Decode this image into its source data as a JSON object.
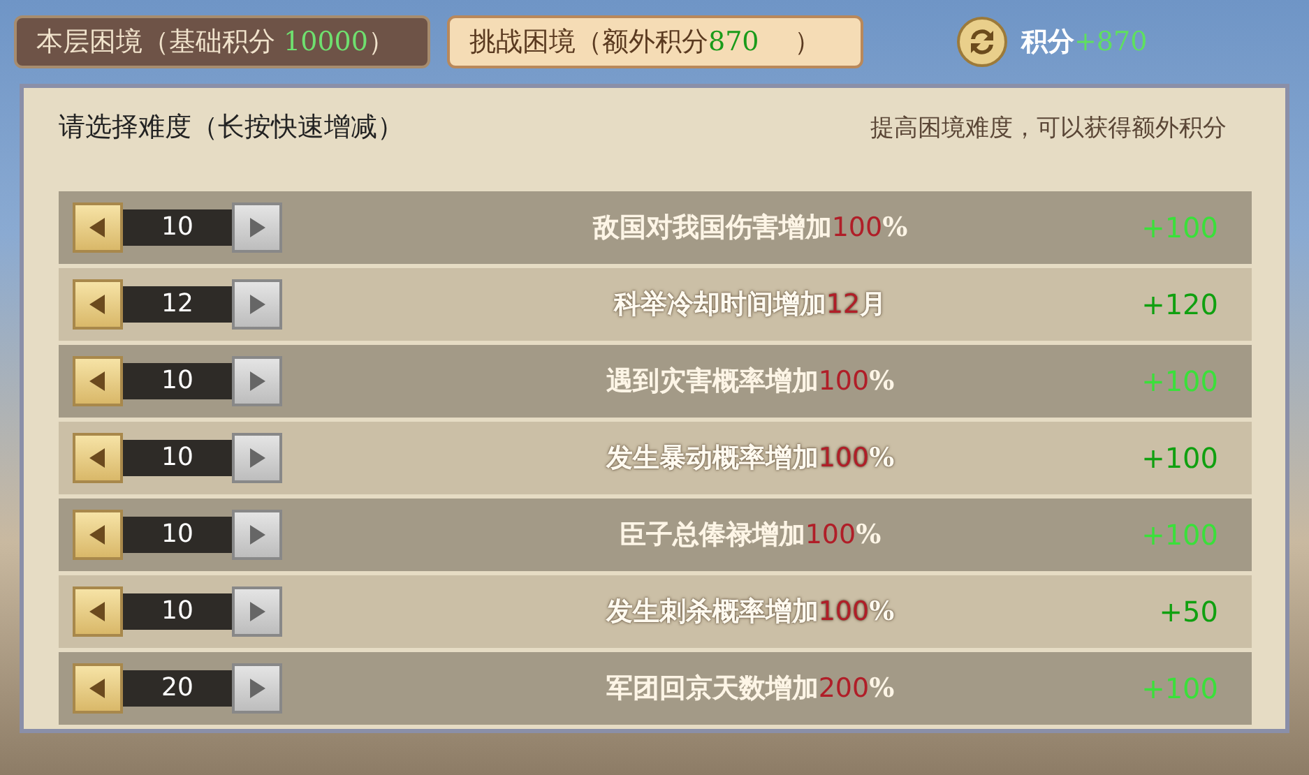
{
  "tabs": [
    {
      "label": "本层困境（基础积分 ",
      "points": "10000",
      "close": "）",
      "selected": false
    },
    {
      "label": "挑战困境（额外积分",
      "points": "870",
      "close": "　 ）",
      "selected": true
    }
  ],
  "score": {
    "label": "积分",
    "value": "+870"
  },
  "panel": {
    "title": "请选择难度（长按快速增减）",
    "hint": "提高困境难度，可以获得额外积分"
  },
  "rows": [
    {
      "count": "10",
      "label": "敌国对我国伤害增加",
      "amount": "100",
      "unit": "%",
      "bonus": "+100"
    },
    {
      "count": "12",
      "label": "科举冷却时间增加",
      "amount": "12",
      "unit": "月",
      "bonus": "+120"
    },
    {
      "count": "10",
      "label": "遇到灾害概率增加",
      "amount": "100",
      "unit": "%",
      "bonus": "+100"
    },
    {
      "count": "10",
      "label": "发生暴动概率增加",
      "amount": "100",
      "unit": "%",
      "bonus": "+100"
    },
    {
      "count": "10",
      "label": "臣子总俸禄增加",
      "amount": "100",
      "unit": "%",
      "bonus": "+100"
    },
    {
      "count": "10",
      "label": "发生刺杀概率增加",
      "amount": "100",
      "unit": "%",
      "bonus": "+50"
    },
    {
      "count": "20",
      "label": "军团回京天数增加",
      "amount": "200",
      "unit": "%",
      "bonus": "+100"
    }
  ]
}
